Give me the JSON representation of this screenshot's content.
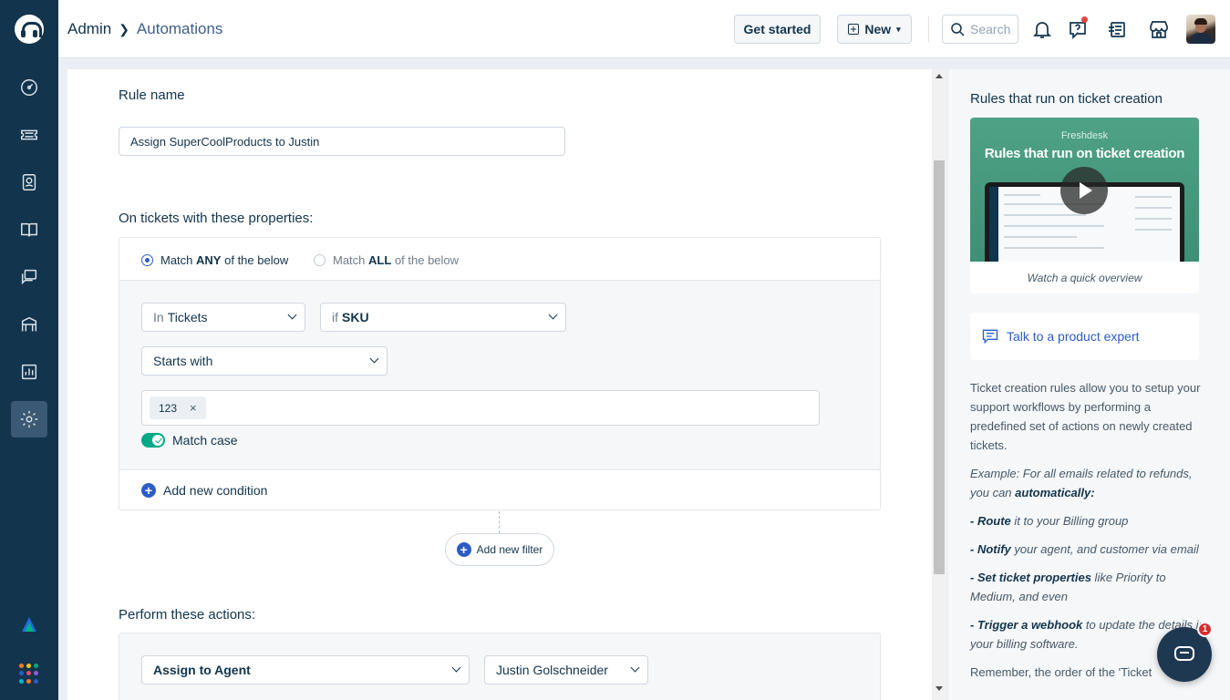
{
  "header": {
    "breadcrumb_root": "Admin",
    "breadcrumb_current": "Automations",
    "get_started": "Get started",
    "new_label": "New",
    "search_placeholder": "Search"
  },
  "sidebar": {
    "items": [
      {
        "icon": "dashboard-icon"
      },
      {
        "icon": "tickets-icon"
      },
      {
        "icon": "contacts-icon"
      },
      {
        "icon": "solutions-icon"
      },
      {
        "icon": "forums-icon"
      },
      {
        "icon": "helpdesk-icon"
      },
      {
        "icon": "reports-icon"
      },
      {
        "icon": "admin-gear-icon",
        "active": true
      }
    ]
  },
  "rule": {
    "name_label": "Rule name",
    "name_value": "Assign SuperCoolProducts to Justin",
    "conditions_label": "On tickets with these properties:",
    "match_any_prefix": "Match",
    "match_any_strong": "ANY",
    "match_any_suffix": "of the below",
    "match_all_prefix": "Match",
    "match_all_strong": "ALL",
    "match_all_suffix": "of the below",
    "in_prefix": "In",
    "in_value": "Tickets",
    "if_prefix": "if",
    "if_value": "SKU",
    "operator": "Starts with",
    "tag_value": "123",
    "tag_remove": "×",
    "match_case": "Match case",
    "add_condition": "Add new condition",
    "add_filter": "Add new filter",
    "actions_label": "Perform these actions:",
    "action_type": "Assign to Agent",
    "action_value": "Justin Golschneider"
  },
  "right_panel": {
    "title": "Rules that run on ticket creation",
    "video_brand": "Freshdesk",
    "video_title": "Rules that run on ticket creation",
    "video_caption": "Watch a quick overview",
    "expert_link": "Talk to a product expert",
    "intro": "Ticket creation rules allow you to setup your support workflows by performing a predefined set of actions on newly created tickets.",
    "example_prefix": "Example: For all emails related to refunds, you can ",
    "example_strong": "automatically:",
    "b1_strong": "- Route",
    "b1_text": " it to your Billing group",
    "b2_strong": "- Notify",
    "b2_text": " your agent, and customer via email",
    "b3_strong": "- Set ticket properties",
    "b3_text": " like Priority to Medium, and even",
    "b4_strong": "- Trigger a webhook",
    "b4_text": " to update the details in your billing software.",
    "remember": "Remember, the order of the 'Ticket"
  },
  "chat": {
    "badge": "1"
  },
  "colors": {
    "accent": "#2c5cc5",
    "sidebar": "#12344d",
    "toggle": "#00a886",
    "badge": "#d72d30"
  }
}
